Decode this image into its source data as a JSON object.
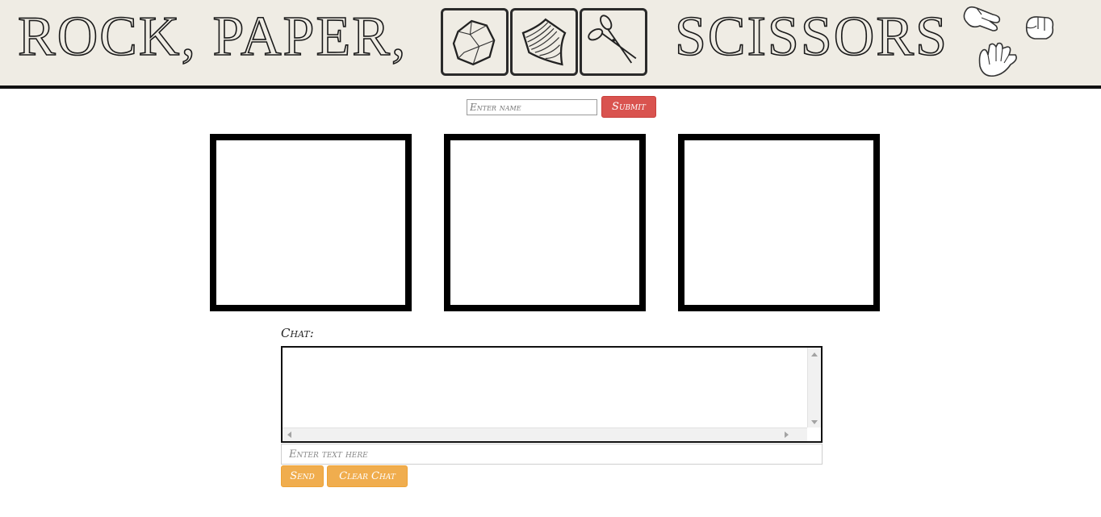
{
  "header": {
    "title_left": "ROCK, PAPER,",
    "title_right": "SCISSORS",
    "icons": [
      "rock-icon",
      "paper-icon",
      "scissors-icon"
    ],
    "hand_icons": [
      "scissors-hand-icon",
      "rock-hand-icon",
      "paper-hand-icon"
    ]
  },
  "name_form": {
    "placeholder": "Enter name",
    "submit_label": "Submit"
  },
  "chat": {
    "label": "Chat:",
    "input_placeholder": "Enter text here",
    "send_label": "Send",
    "clear_label": "Clear Chat"
  },
  "colors": {
    "header_bg": "#efece4",
    "submit_button": "#d9534f",
    "chat_buttons": "#f0ad4e"
  }
}
